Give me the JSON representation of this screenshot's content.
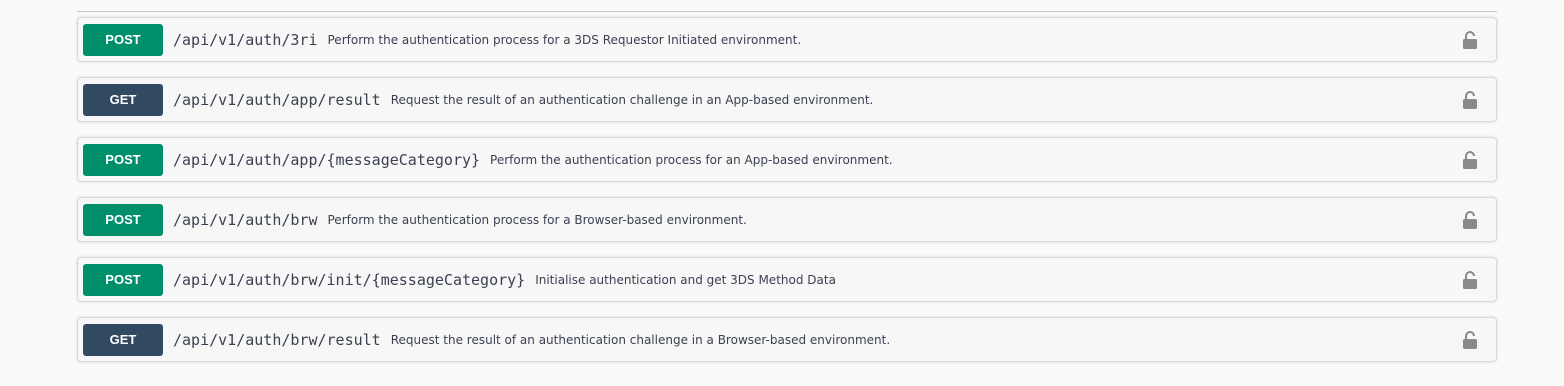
{
  "operations": [
    {
      "method": "POST",
      "path": "/api/v1/auth/3ri",
      "summary": "Perform the authentication process for a 3DS Requestor Initiated environment.",
      "lock_icon": "lock-icon"
    },
    {
      "method": "GET",
      "path": "/api/v1/auth/app/result",
      "summary": "Request the result of an authentication challenge in an App-based environment.",
      "lock_icon": "lock-icon"
    },
    {
      "method": "POST",
      "path": "/api/v1/auth/app/{messageCategory}",
      "summary": "Perform the authentication process for an App-based environment.",
      "lock_icon": "lock-icon"
    },
    {
      "method": "POST",
      "path": "/api/v1/auth/brw",
      "summary": "Perform the authentication process for a Browser-based environment.",
      "lock_icon": "lock-icon"
    },
    {
      "method": "POST",
      "path": "/api/v1/auth/brw/init/{messageCategory}",
      "summary": "Initialise authentication and get 3DS Method Data",
      "lock_icon": "lock-icon"
    },
    {
      "method": "GET",
      "path": "/api/v1/auth/brw/result",
      "summary": "Request the result of an authentication challenge in a Browser-based environment.",
      "lock_icon": "lock-icon"
    }
  ],
  "colors": {
    "post": "#008f6b",
    "get": "#324a61",
    "text": "#3b4151",
    "lock": "#8a8a8a"
  }
}
